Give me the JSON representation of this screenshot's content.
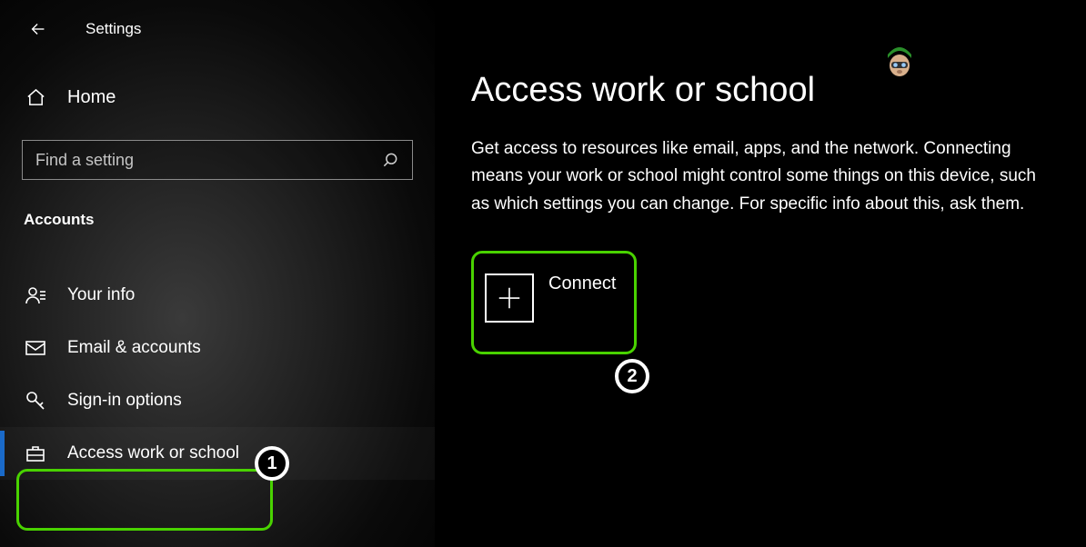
{
  "header": {
    "title": "Settings"
  },
  "sidebar": {
    "home_label": "Home",
    "search_placeholder": "Find a setting",
    "section_label": "Accounts",
    "items": [
      {
        "label": "Your info",
        "icon": "person"
      },
      {
        "label": "Email & accounts",
        "icon": "mail"
      },
      {
        "label": "Sign-in options",
        "icon": "key"
      },
      {
        "label": "Access work or school",
        "icon": "briefcase",
        "active": true
      }
    ]
  },
  "main": {
    "title": "Access work or school",
    "description": "Get access to resources like email, apps, and the network. Connecting means your work or school might control some things on this device, such as which settings you can change. For specific info about this, ask them.",
    "connect_label": "Connect"
  },
  "annotations": {
    "badge1": "1",
    "badge2": "2"
  }
}
